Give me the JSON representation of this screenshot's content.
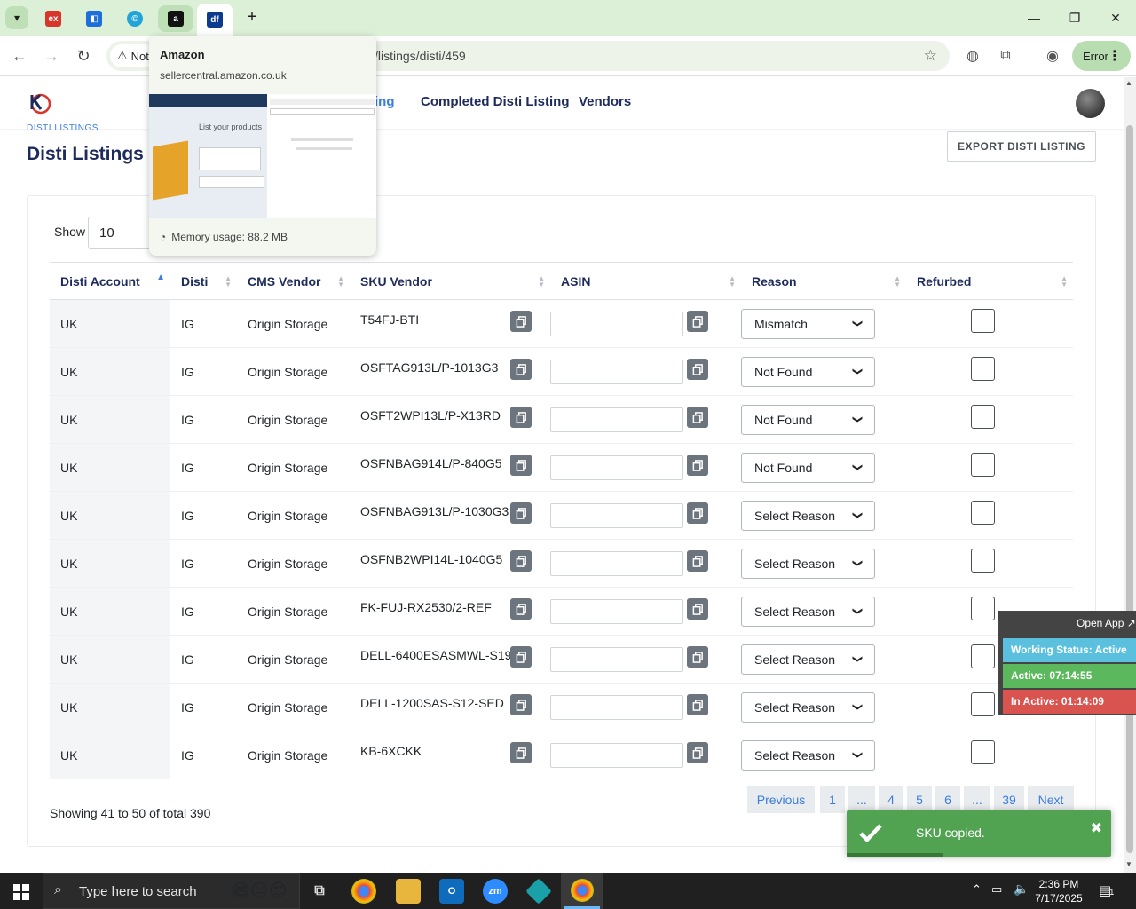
{
  "browser": {
    "hover_card": {
      "title": "Amazon",
      "domain": "sellercentral.amazon.co.uk",
      "memory": "Memory usage: 88.2 MB",
      "thumb_heading": "List your products"
    },
    "omnibox": {
      "security_label": "Not",
      "url": "/listings/disti/459"
    },
    "profile_status": "Error"
  },
  "header": {
    "nav_partial": "ing",
    "nav_items": [
      "Completed Disti Listing",
      "Vendors"
    ]
  },
  "page": {
    "breadcrumb": "DISTI LISTINGS",
    "title": "Disti Listings By",
    "export_label": "EXPORT DISTI LISTING",
    "show_label": "Show",
    "show_value": "10",
    "columns": [
      "Disti Account",
      "Disti",
      "CMS Vendor",
      "SKU Vendor",
      "ASIN",
      "Reason",
      "Refurbed"
    ],
    "rows": [
      {
        "account": "UK",
        "disti": "IG",
        "vendor": "Origin Storage",
        "sku": "T54FJ-BTI",
        "reason": "Mismatch"
      },
      {
        "account": "UK",
        "disti": "IG",
        "vendor": "Origin Storage",
        "sku": "OSFTAG913L/P-1013G3",
        "reason": "Not Found"
      },
      {
        "account": "UK",
        "disti": "IG",
        "vendor": "Origin Storage",
        "sku": "OSFT2WPI13L/P-X13RD",
        "reason": "Not Found"
      },
      {
        "account": "UK",
        "disti": "IG",
        "vendor": "Origin Storage",
        "sku": "OSFNBAG914L/P-840G5",
        "reason": "Not Found"
      },
      {
        "account": "UK",
        "disti": "IG",
        "vendor": "Origin Storage",
        "sku": "OSFNBAG913L/P-1030G3",
        "reason": "Select Reason"
      },
      {
        "account": "UK",
        "disti": "IG",
        "vendor": "Origin Storage",
        "sku": "OSFNB2WPI14L-1040G5",
        "reason": "Select Reason"
      },
      {
        "account": "UK",
        "disti": "IG",
        "vendor": "Origin Storage",
        "sku": "FK-FUJ-RX2530/2-REF",
        "reason": "Select Reason"
      },
      {
        "account": "UK",
        "disti": "IG",
        "vendor": "Origin Storage",
        "sku": "DELL-6400ESASMWL-S19",
        "reason": "Select Reason"
      },
      {
        "account": "UK",
        "disti": "IG",
        "vendor": "Origin Storage",
        "sku": "DELL-1200SAS-S12-SED",
        "reason": "Select Reason"
      },
      {
        "account": "UK",
        "disti": "IG",
        "vendor": "Origin Storage",
        "sku": "KB-6XCKK",
        "reason": "Select Reason"
      }
    ],
    "showing_text": "Showing 41 to 50 of total 390",
    "pagination": [
      "Previous",
      "1",
      "...",
      "4",
      "5",
      "6",
      "...",
      "39",
      "Next"
    ]
  },
  "status_widget": {
    "open_app": "Open App",
    "working": "Working Status: Active",
    "active": "Active: 07:14:55",
    "inactive": "In Active: 01:14:09"
  },
  "toast": {
    "message": "SKU copied.",
    "close": "✖"
  },
  "taskbar": {
    "search_placeholder": "Type here to search",
    "time": "2:36 PM",
    "date": "7/17/2025",
    "notif_count": "1"
  },
  "colors": {
    "accent": "#3b7ddd",
    "heading": "#1d2b5c",
    "toast_green": "#51a351",
    "status_blue": "#5bc0de",
    "status_green": "#5cb85c",
    "status_red": "#d9534f"
  }
}
